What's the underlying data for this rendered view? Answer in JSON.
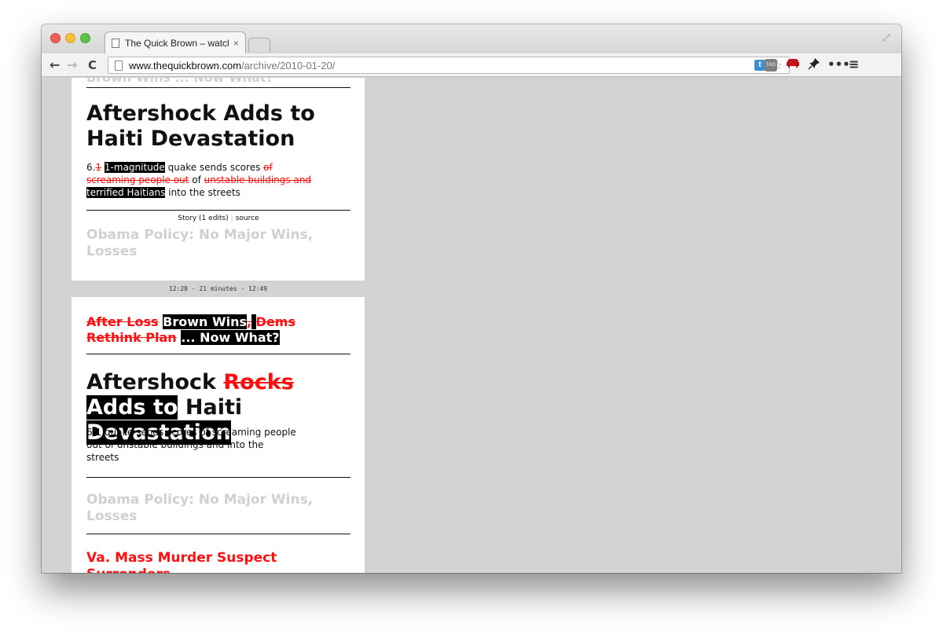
{
  "browser": {
    "tab_title": "The Quick Brown – watchin",
    "tab_close": "×",
    "url_host": "www.thequickbrown.com",
    "url_path": "/archive/2010-01-20/",
    "ext_t_label": "t",
    "ext_tag_label": "TAG",
    "icons": [
      "back-arrow-icon",
      "forward-arrow-icon",
      "reload-icon",
      "page-icon",
      "star-icon",
      "tag-icon",
      "sofa-icon",
      "pin-icon",
      "more-icon",
      "menu-icon"
    ]
  },
  "card1": {
    "cut_headline": "Brown Wins ... Now What?",
    "headline": "Aftershock Adds to Haiti Devastation",
    "dek": {
      "p1": "6.",
      "del1": "1",
      "ins1": "1-magnitude",
      "p2": " quake sends scores ",
      "del2": "of screaming people out",
      "p3": " of ",
      "del3": "unstable buildings and",
      "p4": " ",
      "ins2": "terrified Haitians",
      "p5": " into the streets"
    },
    "meta_story": "Story (1 edits)",
    "meta_sep": "|",
    "meta_source": "source",
    "next_headline": "Obama Policy: No Major Wins, Losses"
  },
  "timeline": "12:28 - 21 minutes - 12:49",
  "card2": {
    "h1": {
      "del1": "After Loss",
      "ins1": "Brown Wins",
      "del2": ",",
      "gap": " ",
      "del3": "Dems Rethink Plan",
      "ins2": "... Now What?"
    },
    "h2": {
      "p1": "Aftershock ",
      "del1": "Rocks",
      "ins1": " Adds to",
      "p2": " Haiti",
      "ins2": " Devastation"
    },
    "dek": "6.1 quake sends scores of screaming people out of unstable buildings and into the streets",
    "grey_headline": "Obama Policy: No Major Wins, Losses",
    "red_headline": "Va. Mass Murder Suspect Surrenders"
  },
  "colors": {
    "deleted": "#ff1010",
    "inserted_bg": "#000000",
    "inserted_fg": "#ffffff",
    "faded": "#d0d0d0"
  }
}
